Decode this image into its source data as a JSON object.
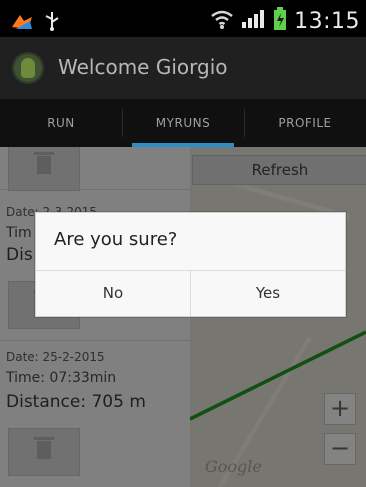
{
  "status_bar": {
    "time": "13:15",
    "icons": [
      "notification-icon",
      "usb-icon",
      "wifi-icon",
      "signal-icon",
      "battery-charging-icon"
    ],
    "battery_color": "#5fd04b"
  },
  "action_bar": {
    "title": "Welcome Giorgio"
  },
  "tabs": [
    {
      "label": "RUN",
      "active": false
    },
    {
      "label": "MYRUNS",
      "active": true
    },
    {
      "label": "PROFILE",
      "active": false
    }
  ],
  "map": {
    "refresh_label": "Refresh",
    "zoom_in_label": "+",
    "zoom_out_label": "−",
    "attribution": "Google",
    "route_color": "#1f9a1f"
  },
  "runs": [
    {
      "date": "Date: 2-3-2015",
      "time": "Tim",
      "distance": "Dis"
    },
    {
      "date": "Date: 25-2-2015",
      "time": "Time: 07:33min",
      "distance": "Distance: 705 m"
    }
  ],
  "dialog": {
    "title": "Are you sure?",
    "no_label": "No",
    "yes_label": "Yes"
  }
}
